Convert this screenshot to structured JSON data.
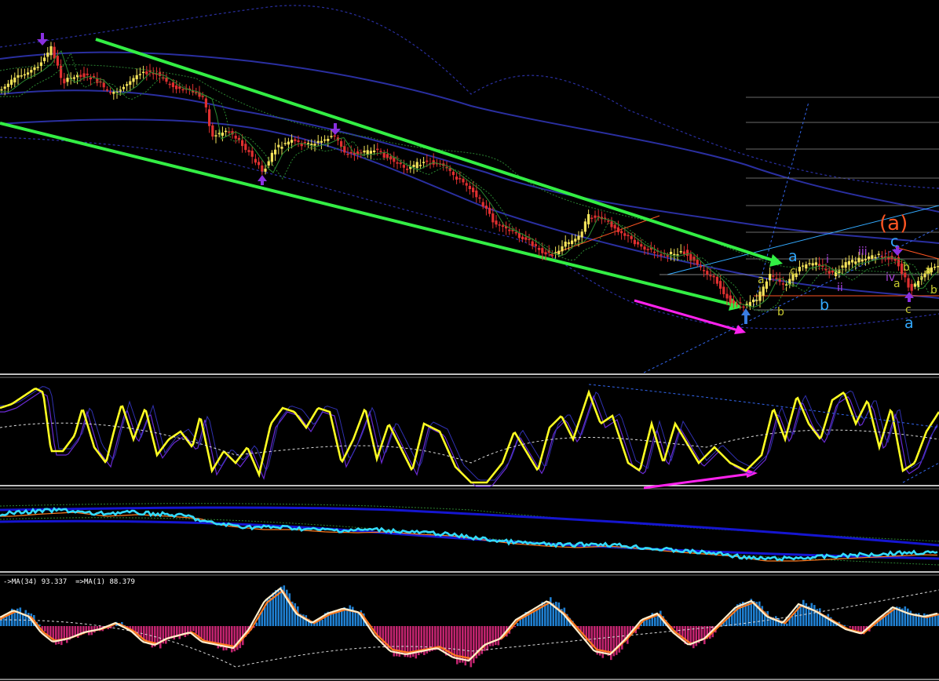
{
  "colors": {
    "background": "#000000",
    "channel": "#33ee44",
    "bull_candle": "#f4e35a",
    "bear_candle": "#e03030",
    "envelope": "#2a2fa0",
    "stoch_main": "#ffff22",
    "stoch_signal": "#6a2bd4",
    "divergence": "#ff22ee",
    "cyan_line": "#33dcff",
    "ma_orange": "#ff7a1f",
    "ma_white": "#ffeecc",
    "hist_pos": "#1f7fd0",
    "hist_neg": "#c0246e",
    "wave_blue": "#33aaff",
    "wave_yellow": "#c8c830",
    "wave_purple": "#aa44dd",
    "wave_orange": "#ff5522"
  },
  "chart_data": [
    {
      "type": "line",
      "panel": "price",
      "x": [
        0,
        20,
        40,
        55,
        65,
        80,
        100,
        120,
        140,
        160,
        180,
        200,
        220,
        240,
        260,
        270,
        290,
        310,
        335,
        350,
        370,
        390,
        410,
        425,
        440,
        460,
        480,
        500,
        520,
        540,
        560,
        580,
        600,
        615,
        630,
        650,
        670,
        690,
        705,
        720,
        735,
        750,
        770,
        790,
        810,
        830,
        850,
        870,
        890,
        910,
        930,
        950,
        965,
        980,
        1000,
        1020,
        1040,
        1060,
        1080,
        1100,
        1120,
        1140,
        1160,
        1180,
        1196
      ],
      "series": [
        {
          "values": [
            115,
            100,
            90,
            78,
            60,
            105,
            95,
            100,
            120,
            110,
            90,
            95,
            110,
            115,
            125,
            175,
            165,
            185,
            220,
            190,
            180,
            185,
            180,
            172,
            195,
            195,
            192,
            205,
            215,
            205,
            210,
            225,
            240,
            260,
            285,
            295,
            305,
            320,
            325,
            310,
            305,
            275,
            280,
            295,
            310,
            320,
            325,
            320,
            340,
            355,
            385,
            390,
            380,
            350,
            365,
            340,
            335,
            350,
            335,
            330,
            325,
            330,
            370,
            345,
            340
          ]
        }
      ],
      "ylim": [
        470,
        0
      ]
    },
    {
      "type": "line",
      "panel": "stochastic",
      "x": [
        0,
        15,
        30,
        45,
        55,
        65,
        80,
        95,
        105,
        120,
        135,
        145,
        155,
        170,
        185,
        200,
        215,
        230,
        245,
        255,
        270,
        285,
        300,
        315,
        330,
        345,
        360,
        375,
        390,
        405,
        420,
        435,
        450,
        465,
        480,
        495,
        510,
        525,
        540,
        560,
        580,
        600,
        620,
        640,
        655,
        670,
        685,
        700,
        715,
        730,
        750,
        765,
        780,
        800,
        815,
        830,
        845,
        860,
        875,
        890,
        910,
        930,
        950,
        970,
        985,
        1000,
        1015,
        1030,
        1045,
        1060,
        1075,
        1090,
        1105,
        1120,
        1135,
        1150,
        1165,
        1180,
        1196
      ],
      "series": [
        {
          "values": [
            520,
            515,
            505,
            495,
            500,
            575,
            575,
            555,
            520,
            570,
            590,
            550,
            515,
            560,
            520,
            580,
            560,
            550,
            570,
            530,
            600,
            575,
            590,
            570,
            605,
            540,
            520,
            525,
            545,
            520,
            525,
            590,
            560,
            520,
            585,
            540,
            570,
            600,
            540,
            550,
            595,
            615,
            615,
            590,
            550,
            575,
            600,
            545,
            530,
            560,
            500,
            540,
            530,
            590,
            600,
            540,
            590,
            540,
            565,
            590,
            570,
            590,
            600,
            580,
            520,
            560,
            505,
            540,
            560,
            510,
            500,
            540,
            510,
            570,
            520,
            600,
            590,
            550,
            525
          ]
        }
      ],
      "ylim": [
        625,
        485
      ]
    },
    {
      "type": "line",
      "panel": "band",
      "x": [
        0,
        40,
        80,
        120,
        160,
        200,
        240,
        260,
        280,
        320,
        360,
        400,
        440,
        480,
        520,
        560,
        600,
        640,
        680,
        720,
        760,
        800,
        840,
        880,
        920,
        960,
        1000,
        1040,
        1080,
        1120,
        1160,
        1196
      ],
      "series": [
        {
          "values": [
            655,
            652,
            650,
            655,
            653,
            655,
            658,
            665,
            668,
            672,
            672,
            675,
            676,
            675,
            678,
            680,
            685,
            690,
            693,
            695,
            693,
            696,
            700,
            703,
            706,
            712,
            712,
            710,
            708,
            706,
            704,
            705
          ]
        }
      ],
      "ylim": [
        725,
        630
      ]
    },
    {
      "type": "bar",
      "panel": "momentum",
      "categories": [
        "MA(34) 93.337",
        "MA(1) 88.379"
      ],
      "values": [
        93.337,
        88.379
      ],
      "x": [
        0,
        20,
        40,
        55,
        70,
        90,
        110,
        130,
        150,
        170,
        185,
        200,
        215,
        230,
        245,
        260,
        280,
        300,
        320,
        340,
        360,
        380,
        400,
        420,
        440,
        460,
        480,
        500,
        520,
        540,
        560,
        580,
        600,
        620,
        640,
        660,
        680,
        700,
        720,
        740,
        760,
        780,
        800,
        820,
        840,
        860,
        880,
        900,
        920,
        940,
        960,
        980,
        1000,
        1020,
        1040,
        1060,
        1080,
        1100,
        1120,
        1140,
        1160,
        1180,
        1196
      ],
      "series": [
        {
          "values": [
            12,
            25,
            15,
            -10,
            -25,
            -20,
            -10,
            -5,
            5,
            -8,
            -25,
            -30,
            -20,
            -15,
            -10,
            -25,
            -30,
            -35,
            -5,
            40,
            60,
            20,
            5,
            20,
            28,
            22,
            -15,
            -40,
            -45,
            -40,
            -35,
            -50,
            -55,
            -30,
            -20,
            10,
            25,
            40,
            20,
            -10,
            -40,
            -45,
            -20,
            10,
            20,
            -10,
            -30,
            -20,
            5,
            30,
            40,
            15,
            5,
            35,
            25,
            10,
            -5,
            -12,
            10,
            30,
            20,
            15,
            20
          ]
        }
      ],
      "ylim": [
        -60,
        60
      ]
    }
  ],
  "annotations": {
    "wave_a_big": "(a)",
    "wave_c": "c",
    "wave_a_blue1": "a",
    "wave_b_blue": "b",
    "wave_a_blue2": "a",
    "wave_c_small": "c",
    "small_a1": "a",
    "small_c1": "c",
    "small_b1": "b",
    "roman_i": "i",
    "roman_ii": "ii",
    "roman_iii": "iii",
    "roman_iv": "iv",
    "small_a2": "a",
    "small_b2": "b",
    "small_a3": "a",
    "small_b3": "b"
  },
  "indicator_text": "->MA(34) 93.337  =>MA(1) 88.379"
}
